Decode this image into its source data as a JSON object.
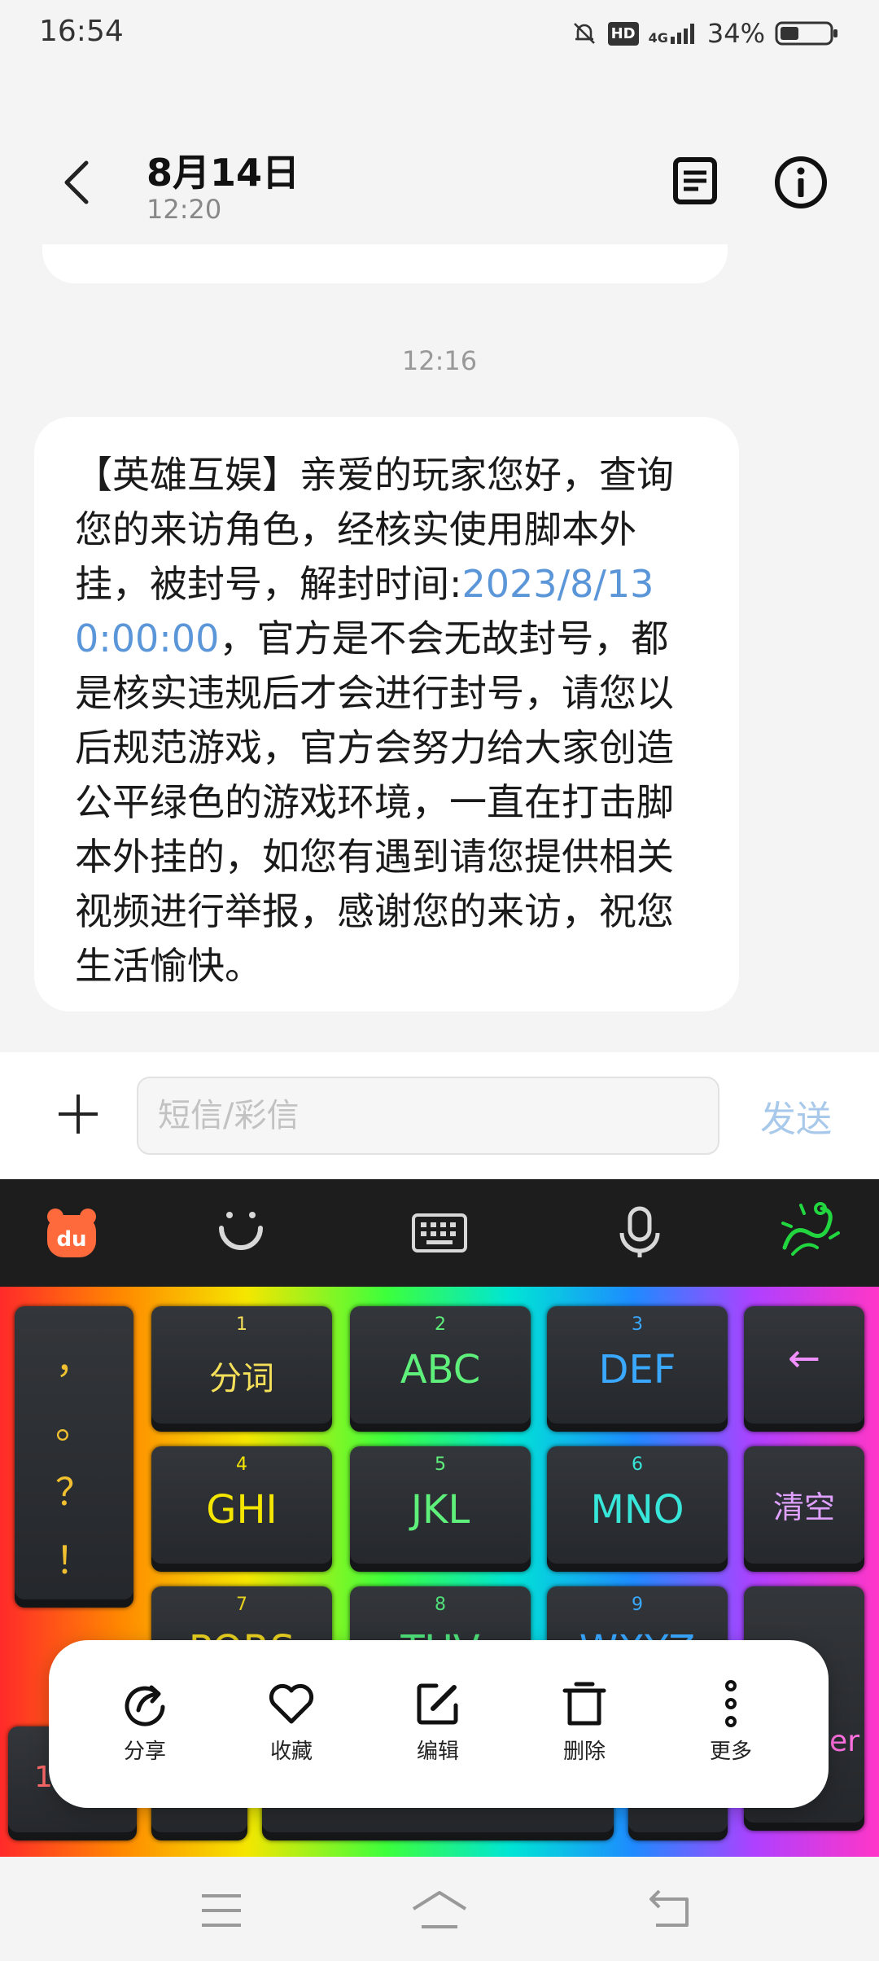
{
  "status_bar": {
    "time": "16:54",
    "network": "4G",
    "hd": "HD",
    "battery": "34%"
  },
  "header": {
    "title": "8月14日",
    "subtitle": "12:20"
  },
  "message": {
    "time": "12:16",
    "text_before": "【英雄互娱】亲爱的玩家您好，查询您的来访角色，经核实使用脚本外挂，被封号，解封时间:",
    "link": "2023/8/13 0:00:00",
    "text_after": "，官方是不会无故封号，都是核实违规后才会进行封号，请您以后规范游戏，官方会努力给大家创造公平绿色的游戏环境，一直在打击脚本外挂的，如您有遇到请您提供相关视频进行举报，感谢您的来访，祝您生活愉快。"
  },
  "composer": {
    "placeholder": "短信/彩信",
    "send": "发送"
  },
  "keyboard": {
    "side_keys": [
      "，",
      "。",
      "？",
      "！"
    ],
    "keys": [
      {
        "num": "1",
        "label": "分词",
        "color": "#f5e05a"
      },
      {
        "num": "2",
        "label": "ABC",
        "color": "#5ef07a"
      },
      {
        "num": "3",
        "label": "DEF",
        "color": "#3aa8ff"
      },
      {
        "num": "4",
        "label": "GHI",
        "color": "#f5e600"
      },
      {
        "num": "5",
        "label": "JKL",
        "color": "#5ef07a"
      },
      {
        "num": "6",
        "label": "MNO",
        "color": "#37e6d8"
      },
      {
        "num": "7",
        "label": "PQRS",
        "color": "#e8d020"
      },
      {
        "num": "8",
        "label": "TUV",
        "color": "#4fe07a"
      },
      {
        "num": "9",
        "label": "WXYZ",
        "color": "#3aa8ff"
      }
    ],
    "backspace": "←",
    "clear": "清空",
    "enter_fragment": "er",
    "shift_fragment": "1"
  },
  "actions": [
    {
      "label": "分享",
      "icon": "share-icon"
    },
    {
      "label": "收藏",
      "icon": "heart-icon"
    },
    {
      "label": "编辑",
      "icon": "edit-icon"
    },
    {
      "label": "删除",
      "icon": "trash-icon"
    },
    {
      "label": "更多",
      "icon": "more-icon"
    }
  ],
  "colors": {
    "link": "#5b96d9",
    "send_disabled": "#a9c9ea",
    "bubble": "#ffffff",
    "background": "#f4f4f4"
  }
}
